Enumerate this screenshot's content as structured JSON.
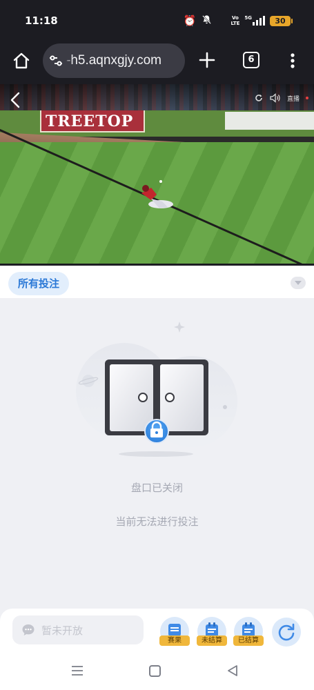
{
  "status_bar": {
    "time": "11:18",
    "network_label_top": "Vo",
    "network_label_bottom": "LTE",
    "signal_label": "5G",
    "battery": "30"
  },
  "browser": {
    "url": "-h5.aqnxgjy.com",
    "tab_count": "6"
  },
  "video": {
    "wall_sign": "TREETOP",
    "live_label": "直播"
  },
  "bet_panel": {
    "tab_label": "所有投注",
    "empty_title": "盘口已关闭",
    "empty_subtitle": "当前无法进行投注"
  },
  "bottom_bar": {
    "chat_placeholder": "暂未开放",
    "actions": [
      {
        "label": "赛果"
      },
      {
        "label": "未结算"
      },
      {
        "label": "已结算"
      }
    ]
  },
  "colors": {
    "accent": "#2a78d6",
    "tag": "#f0b73b",
    "chrome_dark": "#1c1c22"
  }
}
